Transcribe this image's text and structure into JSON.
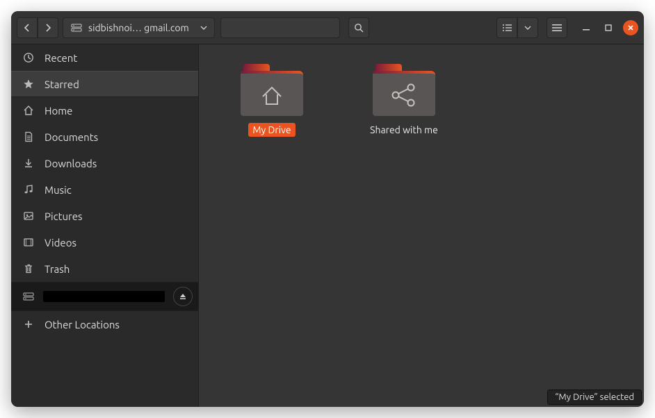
{
  "titlebar": {
    "path_label": "sidbishnoi… gmail.com"
  },
  "sidebar": {
    "items": [
      {
        "icon": "clock",
        "label": "Recent"
      },
      {
        "icon": "star",
        "label": "Starred",
        "active": true
      },
      {
        "icon": "home",
        "label": "Home"
      },
      {
        "icon": "doc",
        "label": "Documents"
      },
      {
        "icon": "download",
        "label": "Downloads"
      },
      {
        "icon": "music",
        "label": "Music"
      },
      {
        "icon": "picture",
        "label": "Pictures"
      },
      {
        "icon": "video",
        "label": "Videos"
      },
      {
        "icon": "trash",
        "label": "Trash"
      }
    ],
    "other_label": "Other Locations"
  },
  "main": {
    "folders": [
      {
        "name": "My Drive",
        "glyph": "home",
        "selected": true
      },
      {
        "name": "Shared with me",
        "glyph": "share",
        "selected": false
      }
    ]
  },
  "statusbar": {
    "text": "“My Drive” selected"
  },
  "colors": {
    "accent": "#e95420",
    "folder_tab_gradient": [
      "#7a1c3a",
      "#e95420"
    ]
  }
}
